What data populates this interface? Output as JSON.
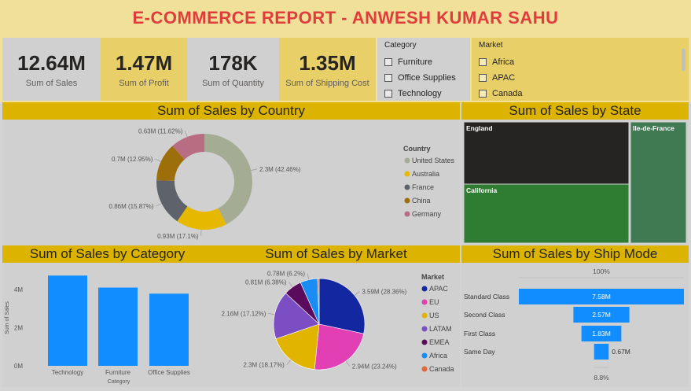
{
  "header": {
    "title": "E-COMMERCE REPORT - ANWESH KUMAR SAHU"
  },
  "kpis": [
    {
      "value": "12.64M",
      "label": "Sum of Sales"
    },
    {
      "value": "1.47M",
      "label": "Sum of Profit"
    },
    {
      "value": "178K",
      "label": "Sum of Quantity"
    },
    {
      "value": "1.35M",
      "label": "Sum of Shipping Cost"
    }
  ],
  "slicers": {
    "category": {
      "title": "Category",
      "options": [
        "Furniture",
        "Office Supplies",
        "Technology"
      ]
    },
    "market": {
      "title": "Market",
      "options": [
        "Africa",
        "APAC",
        "Canada"
      ]
    }
  },
  "colors": {
    "kpi_gray": "#d0d0d0",
    "kpi_yellow": "#e8cf68",
    "header_gold": "#dcb400",
    "title_red": "#e03c3c",
    "bar_blue": "#118dff"
  },
  "chart_data": [
    {
      "type": "donut",
      "title": "Sum of Sales by Country",
      "legend_title": "Country",
      "categories": [
        "United States",
        "Australia",
        "France",
        "China",
        "Germany"
      ],
      "values": [
        2.3,
        0.93,
        0.86,
        0.7,
        0.63
      ],
      "labels": [
        "2.3M (42.46%)",
        "0.93M (17.1%)",
        "0.86M (15.87%)",
        "0.7M (12.95%)",
        "0.63M (11.62%)"
      ],
      "colors": [
        "#a4ad94",
        "#e6b800",
        "#5e636b",
        "#9c6f0a",
        "#b86d82"
      ]
    },
    {
      "type": "treemap",
      "title": "Sum of Sales by State",
      "categories": [
        "England",
        "California",
        "Ile-de-France"
      ],
      "colors": [
        "#252423",
        "#2f7d32",
        "#3f7a52"
      ]
    },
    {
      "type": "bar",
      "title": "Sum of Sales by Category",
      "categories": [
        "Technology",
        "Furniture",
        "Office Supplies"
      ],
      "values": [
        4.74,
        4.11,
        3.79
      ],
      "xlabel": "Category",
      "ylabel": "Sum of Sales",
      "yticks": [
        "0M",
        "2M",
        "4M"
      ],
      "ylim": [
        0,
        5
      ]
    },
    {
      "type": "pie",
      "title": "Sum of Sales by Market",
      "legend_title": "Market",
      "categories": [
        "APAC",
        "EU",
        "US",
        "LATAM",
        "EMEA",
        "Africa",
        "Canada"
      ],
      "values": [
        3.59,
        2.94,
        2.3,
        2.16,
        0.81,
        0.78,
        0.07
      ],
      "labels": [
        "3.59M (28.36%)",
        "2.94M (23.24%)",
        "2.3M (18.17%)",
        "2.16M (17.12%)",
        "0.81M (6.38%)",
        "0.78M (6.2%)",
        ""
      ],
      "colors": [
        "#1327a0",
        "#e23fb4",
        "#e1b400",
        "#7b4ec4",
        "#5a0b5c",
        "#1a8df5",
        "#e0683a"
      ]
    },
    {
      "type": "funnel",
      "title": "Sum of Sales by Ship Mode",
      "categories": [
        "Standard Class",
        "Second Class",
        "First Class",
        "Same Day"
      ],
      "values": [
        7.58,
        2.57,
        1.83,
        0.67
      ],
      "labels": [
        "7.58M",
        "2.57M",
        "1.83M",
        "0.67M"
      ],
      "top_pct": "100%",
      "bottom_pct": "8.8%"
    }
  ]
}
